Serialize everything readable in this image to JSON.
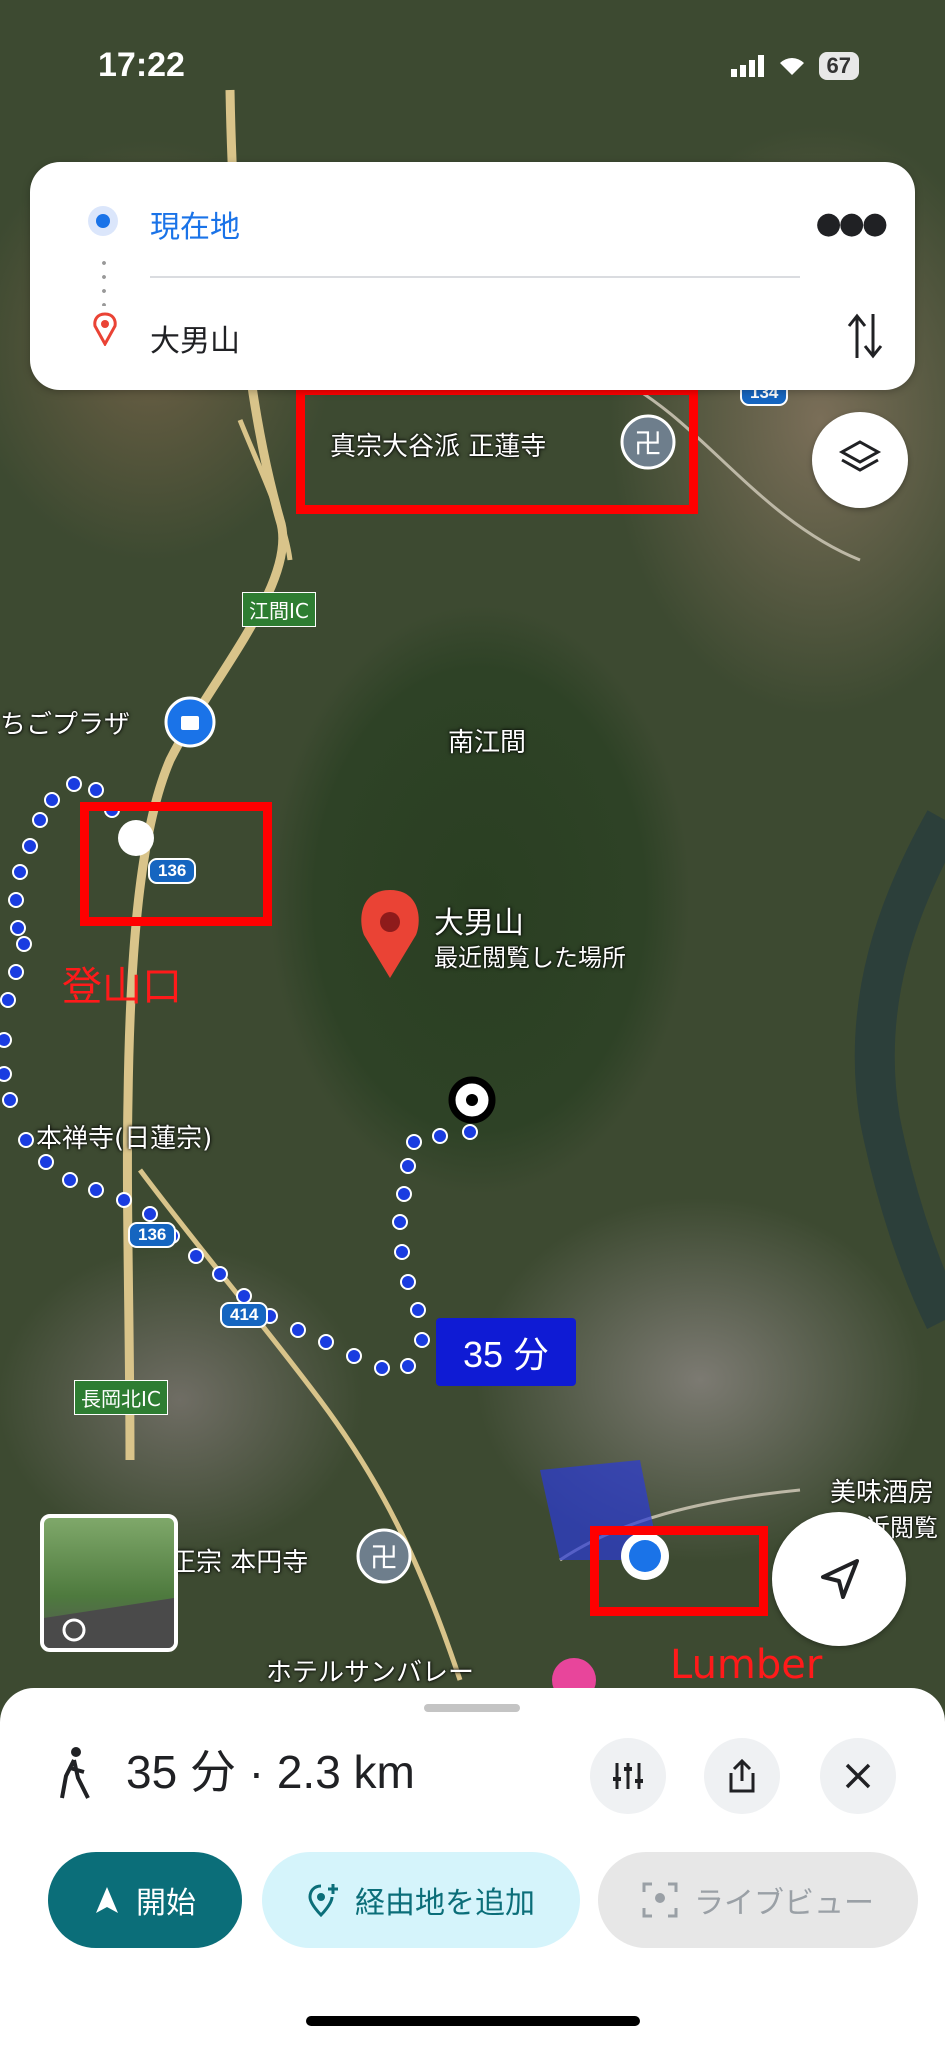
{
  "status_bar": {
    "time": "17:22",
    "battery": "67"
  },
  "directions": {
    "origin": "現在地",
    "destination": "大男山",
    "more_icon": "more-horiz-icon",
    "swap_icon": "swap-vert-icon"
  },
  "map": {
    "labels": {
      "temple_top": "真宗大谷派 正蓮寺",
      "ic_top": "江間IC",
      "plaza": "ちごプラザ",
      "area": "南江間",
      "dest_name": "大男山",
      "dest_sub": "最近閲覧した場所",
      "temple_left": "本禅寺(日蓮宗)",
      "ic_bottom": "長岡北IC",
      "temple_bottom": "正宗 本円寺",
      "hotel": "ホテルサンバレー",
      "sake": "美味酒房",
      "sake2": "近閲覧"
    },
    "road_badges": {
      "r136a": "136",
      "r136b": "136",
      "r414": "414",
      "r134": "134"
    },
    "route_time": "35 分",
    "annotations": {
      "trailhead": "登山口",
      "lumber": "Lumber"
    }
  },
  "sheet": {
    "summary": "35 分 · 2.3 km",
    "start_label": "開始",
    "add_stop_label": "経由地を追加",
    "live_view_label": "ライブビュー"
  },
  "colors": {
    "accent": "#1a73e8",
    "route": "#1a3ce0",
    "teal": "#0b6e79",
    "annotation": "#ff0000"
  }
}
